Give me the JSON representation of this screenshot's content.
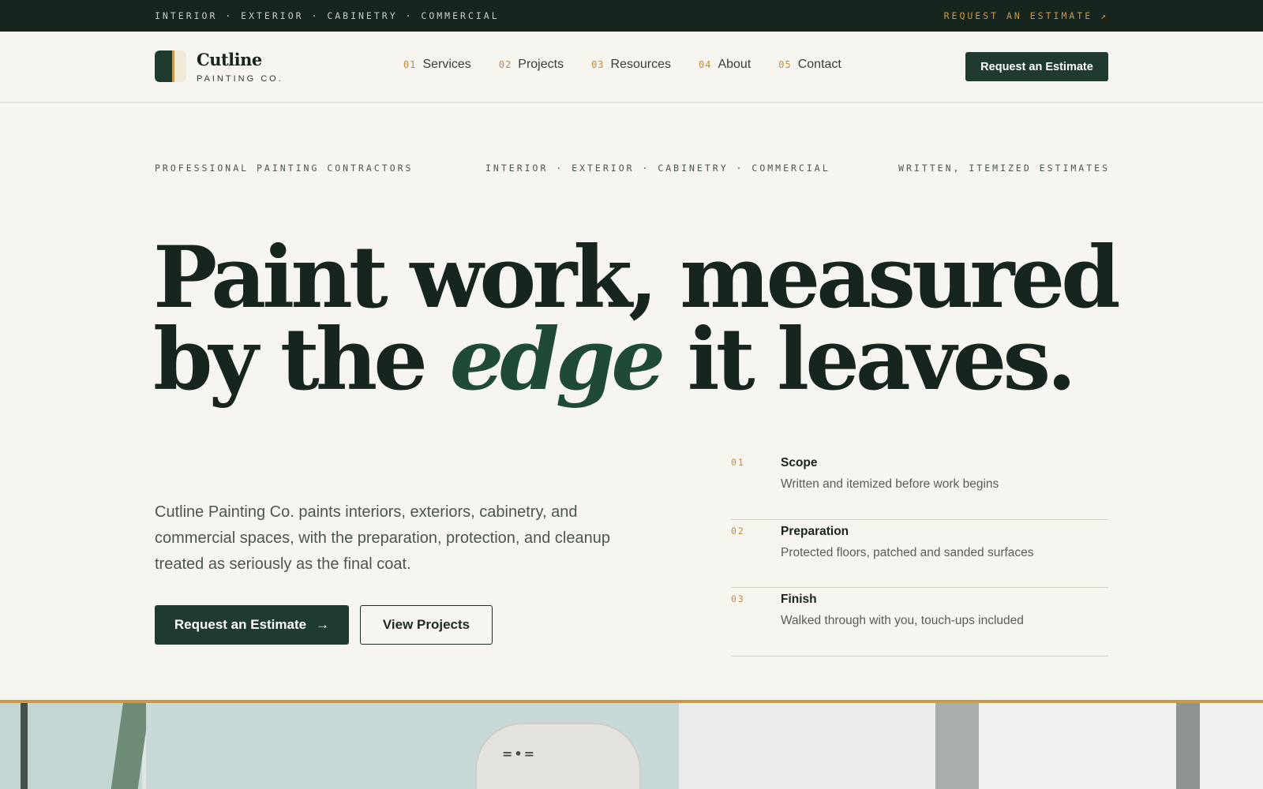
{
  "topbar": {
    "services": "INTERIOR · EXTERIOR · CABINETRY · COMMERCIAL",
    "cta": "REQUEST AN ESTIMATE ↗"
  },
  "brand": {
    "name": "Cutline",
    "sub": "PAINTING CO."
  },
  "nav": {
    "items": [
      {
        "num": "01",
        "label": "Services"
      },
      {
        "num": "02",
        "label": "Projects"
      },
      {
        "num": "03",
        "label": "Resources"
      },
      {
        "num": "04",
        "label": "About"
      },
      {
        "num": "05",
        "label": "Contact"
      }
    ],
    "cta": "Request an Estimate"
  },
  "meta": {
    "left": "PROFESSIONAL PAINTING CONTRACTORS",
    "center": "INTERIOR · EXTERIOR · CABINETRY · COMMERCIAL",
    "right": "WRITTEN, ITEMIZED ESTIMATES"
  },
  "hero": {
    "line1": "Paint work, measured",
    "line2_pre": "by the ",
    "line2_em": "edge",
    "line2_post": " it leaves.",
    "lede": "Cutline Painting Co. paints interiors, exteriors, cabinetry, and commercial spaces, with the preparation, protection, and cleanup treated as seriously as the final coat.",
    "primary_btn": "Request an Estimate",
    "primary_icon": "→",
    "secondary_btn": "View Projects"
  },
  "steps": [
    {
      "num": "01",
      "title": "Scope",
      "desc": "Written and itemized before work begins"
    },
    {
      "num": "02",
      "title": "Preparation",
      "desc": "Protected floors, patched and sanded surfaces"
    },
    {
      "num": "03",
      "title": "Finish",
      "desc": "Walked through with you, touch-ups included"
    }
  ],
  "photo": {
    "bucket_label": "=•="
  },
  "colors": {
    "accent_green": "#1f3a2e",
    "accent_gold": "#c89a4e",
    "background": "#f6f5ef"
  }
}
